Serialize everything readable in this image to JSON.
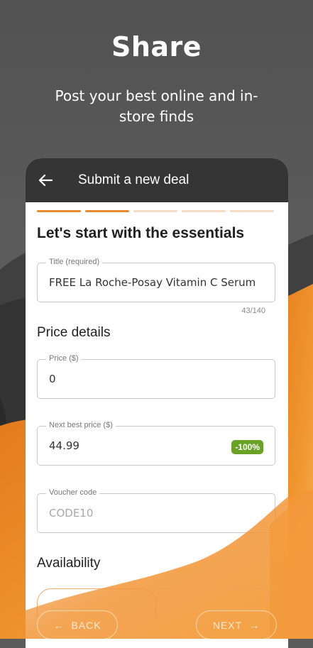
{
  "hero": {
    "title": "Share",
    "subtitle": "Post your best online and in-store finds"
  },
  "appbar": {
    "title": "Submit a new deal"
  },
  "progress": {
    "total_steps": 5,
    "completed_steps": 2
  },
  "section_title": "Let's start with the essentials",
  "fields": {
    "title": {
      "label": "Title (required)",
      "value": "FREE La Roche-Posay Vitamin C Serum",
      "counter": "43/140"
    },
    "price": {
      "label": "Price ($)",
      "value": "0"
    },
    "next_best_price": {
      "label": "Next best price ($)",
      "value": "44.99",
      "badge": "-100%"
    },
    "voucher": {
      "label": "Voucher code",
      "placeholder": "CODE10"
    }
  },
  "price_heading": "Price details",
  "availability_heading": "Availability",
  "buttons": {
    "back": "BACK",
    "next": "NEXT"
  },
  "colors": {
    "accent": "#e88b2e",
    "badge": "#6aa225",
    "appbar": "#353535"
  }
}
